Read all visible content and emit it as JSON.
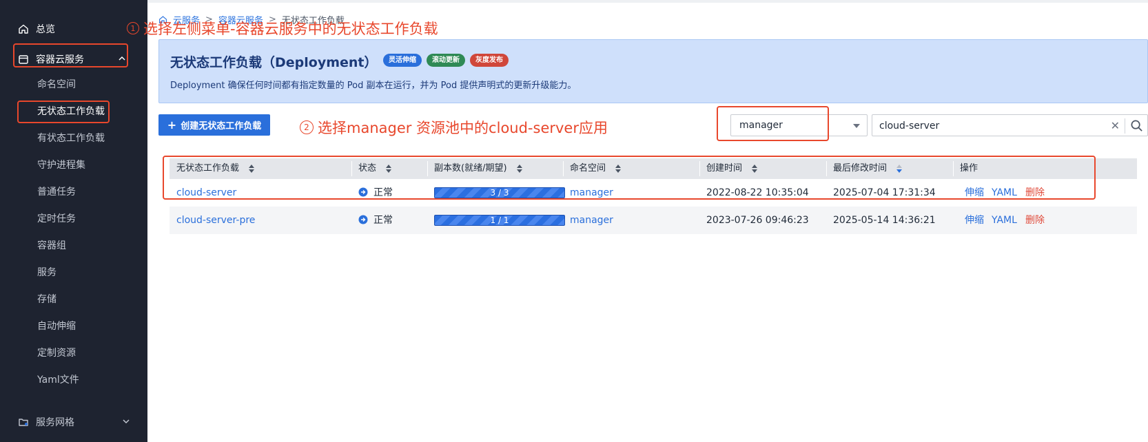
{
  "sidebar": {
    "overview": "总览",
    "group": "容器云服务",
    "items": [
      "命名空间",
      "无状态工作负载",
      "有状态工作负载",
      "守护进程集",
      "普通任务",
      "定时任务",
      "容器组",
      "服务",
      "存储",
      "自动伸缩",
      "定制资源",
      "Yaml文件"
    ],
    "active_index": 1,
    "bottom_group": "服务网格"
  },
  "breadcrumb": [
    "云服务",
    "容器云服务",
    "无状态工作负载"
  ],
  "annotations": {
    "step1_num": "1",
    "step1_text": "选择左侧菜单-容器云服务中的无状态工作负载",
    "step2_num": "2",
    "step2_text": "选择manager 资源池中的cloud-server应用"
  },
  "banner": {
    "title": "无状态工作负载（Deployment）",
    "tags": [
      {
        "label": "灵活伸缩",
        "color": "#2a6fdb"
      },
      {
        "label": "滚动更新",
        "color": "#2f8a55"
      },
      {
        "label": "灰度发布",
        "color": "#d0473a"
      }
    ],
    "description": "Deployment 确保任何时间都有指定数量的 Pod 副本在运行，并为 Pod 提供声明式的更新升级能力。"
  },
  "toolbar": {
    "create_label": "创建无状态工作负载",
    "namespace_value": "manager",
    "search_value": "cloud-server"
  },
  "table": {
    "headers": [
      "无状态工作负载",
      "状态",
      "副本数(就绪/期望)",
      "命名空间",
      "创建时间",
      "最后修改时间",
      "操作"
    ],
    "rows": [
      {
        "name": "cloud-server",
        "status": "正常",
        "replicas": "3 / 3",
        "ready_fraction": 1.0,
        "namespace": "manager",
        "created": "2022-08-22 10:35:04",
        "modified": "2025-07-04 17:31:34",
        "actions": [
          "伸缩",
          "YAML",
          "删除"
        ]
      },
      {
        "name": "cloud-server-pre",
        "status": "正常",
        "replicas": "1 / 1",
        "ready_fraction": 1.0,
        "namespace": "manager",
        "created": "2023-07-26 09:46:23",
        "modified": "2025-05-14 14:36:21",
        "actions": [
          "伸缩",
          "YAML",
          "删除"
        ]
      }
    ]
  },
  "colors": {
    "accent": "#2a6fdb",
    "annotation_red": "#e8472c",
    "sidebar_bg": "#1e2330",
    "banner_bg": "#cfe0fb"
  }
}
